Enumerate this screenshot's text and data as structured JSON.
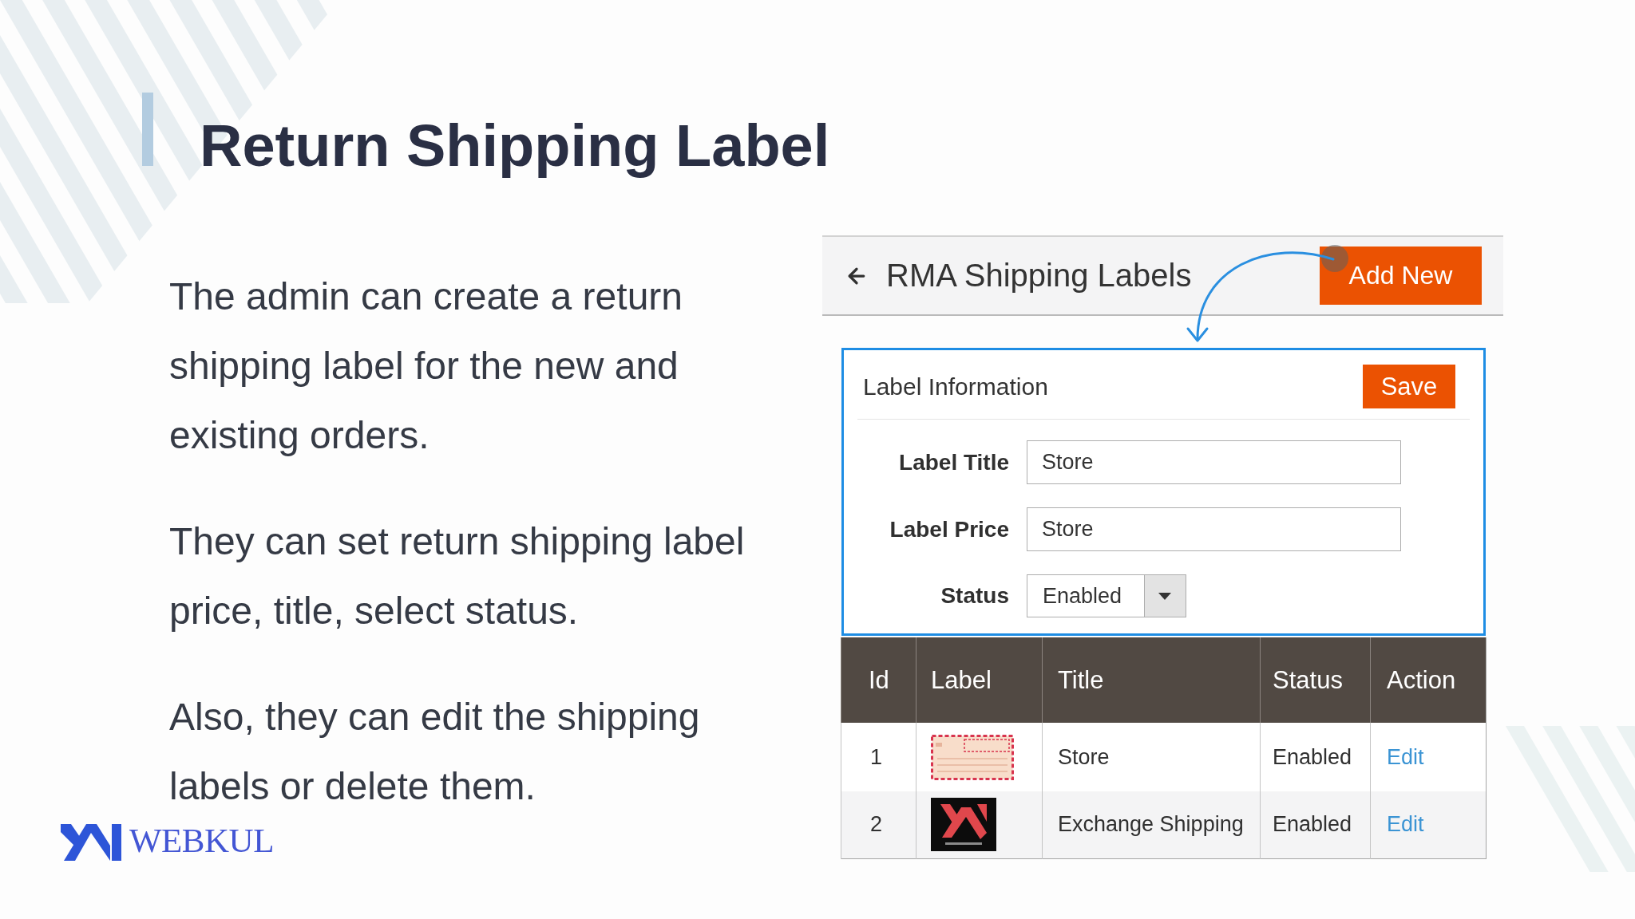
{
  "slide": {
    "title": "Return Shipping Label",
    "paragraphs": [
      "The admin can create a return shipping label for the new and existing orders.",
      "They can set return shipping label price, title, select status.",
      "Also, they can edit the shipping labels or delete them."
    ]
  },
  "logo": {
    "text": "WEBKUL"
  },
  "admin_screen": {
    "header": {
      "title": "RMA Shipping Labels",
      "add_button": "Add New"
    },
    "form": {
      "heading": "Label Information",
      "save_button": "Save",
      "fields": [
        {
          "kind": "text",
          "label": "Label Title",
          "value": "Store"
        },
        {
          "kind": "text",
          "label": "Label Price",
          "value": "Store"
        },
        {
          "kind": "select",
          "label": "Status",
          "value": "Enabled"
        }
      ]
    },
    "table": {
      "columns": [
        "Id",
        "Label",
        "Title",
        "Status",
        "Action"
      ],
      "rows": [
        {
          "kind": "envelope",
          "id": "1",
          "title": "Store",
          "status": "Enabled",
          "action": "Edit"
        },
        {
          "kind": "logo",
          "id": "2",
          "title": "Exchange Shipping",
          "status": "Enabled",
          "action": "Edit"
        }
      ]
    }
  }
}
